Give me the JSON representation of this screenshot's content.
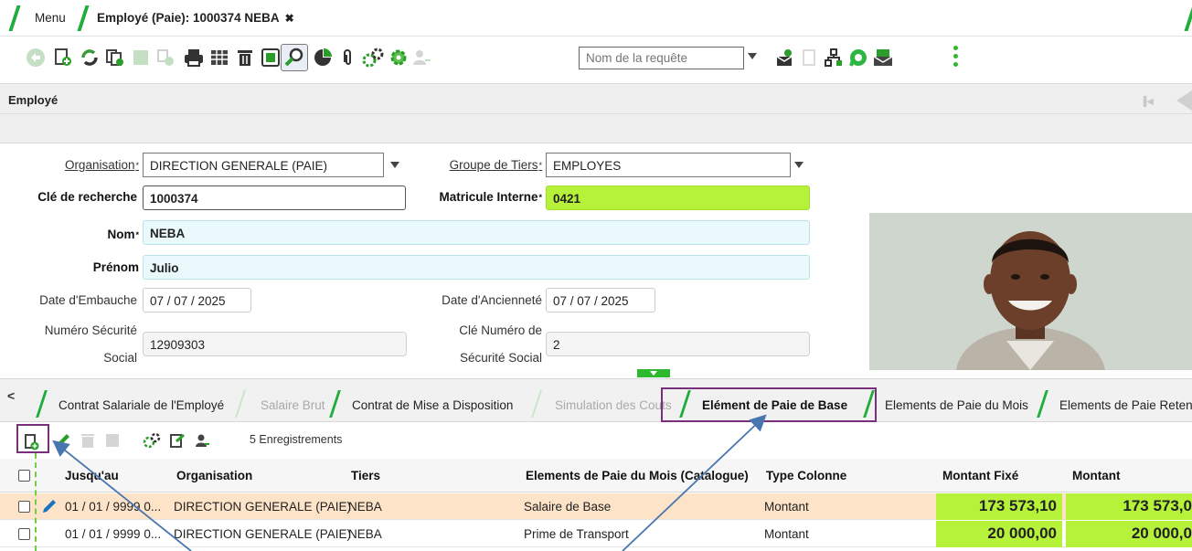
{
  "window_tabs": [
    {
      "label": "Menu"
    },
    {
      "label": "Employé (Paie): 1000374 NEBA",
      "close": "✖"
    }
  ],
  "toolbar": {
    "query_placeholder": "Nom de la requête"
  },
  "panel": {
    "title": "Employé"
  },
  "form": {
    "organisation": {
      "label": "Organisation",
      "value": "DIRECTION GENERALE (PAIE)"
    },
    "groupe_tiers": {
      "label": "Groupe de Tiers",
      "value": "EMPLOYES"
    },
    "cle_recherche": {
      "label": "Clé de recherche",
      "value": "1000374"
    },
    "matricule": {
      "label": "Matricule Interne",
      "value": "0421"
    },
    "nom": {
      "label": "Nom",
      "value": "NEBA"
    },
    "prenom": {
      "label": "Prénom",
      "value": "Julio"
    },
    "date_embauche": {
      "label": "Date d'Embauche",
      "value": "07 / 07 / 2025"
    },
    "date_anciennete": {
      "label": "Date d'Ancienneté",
      "value": "07 / 07 / 2025"
    },
    "num_secu": {
      "label_1": "Numéro Sécurité",
      "label_2": "Social",
      "value": "12909303"
    },
    "cle_secu": {
      "label_1": "Clé Numéro de",
      "label_2": "Sécurité Social",
      "value": "2"
    },
    "required_mark": "*"
  },
  "detail_tabs": [
    {
      "label": "Contrat Salariale de l'Employé"
    },
    {
      "label": "Salaire Brut"
    },
    {
      "label": "Contrat de Mise a Disposition"
    },
    {
      "label": "Simulation des Couts"
    },
    {
      "label": "Elément de Paie de Base"
    },
    {
      "label": "Elements de Paie du Mois"
    },
    {
      "label": "Elements de Paie Reten"
    }
  ],
  "grid": {
    "count": "5 Enregistrements",
    "columns": [
      "Jusqu'au",
      "Organisation",
      "Tiers",
      "Elements de Paie du Mois (Catalogue)",
      "Type Colonne",
      "Montant Fixé",
      "Montant"
    ],
    "rows": [
      {
        "jusquau": "01 / 01 / 9999 0...",
        "organisation": "DIRECTION GENERALE (PAIE)",
        "tiers": "NEBA",
        "element": "Salaire de Base",
        "type": "Montant",
        "montant_fixe": "173 573,10",
        "montant": "173 573,0"
      },
      {
        "jusquau": "01 / 01 / 9999 0...",
        "organisation": "DIRECTION GENERALE (PAIE)",
        "tiers": "NEBA",
        "element": "Prime de Transport",
        "type": "Montant",
        "montant_fixe": "20 000,00",
        "montant": "20 000,0"
      }
    ]
  },
  "colors": {
    "accent_green": "#1fae3c",
    "field_green": "#b6f23a",
    "row_selected": "#fde3c8",
    "highlight_box": "#7a2f7c",
    "arrow": "#4a76b0"
  }
}
